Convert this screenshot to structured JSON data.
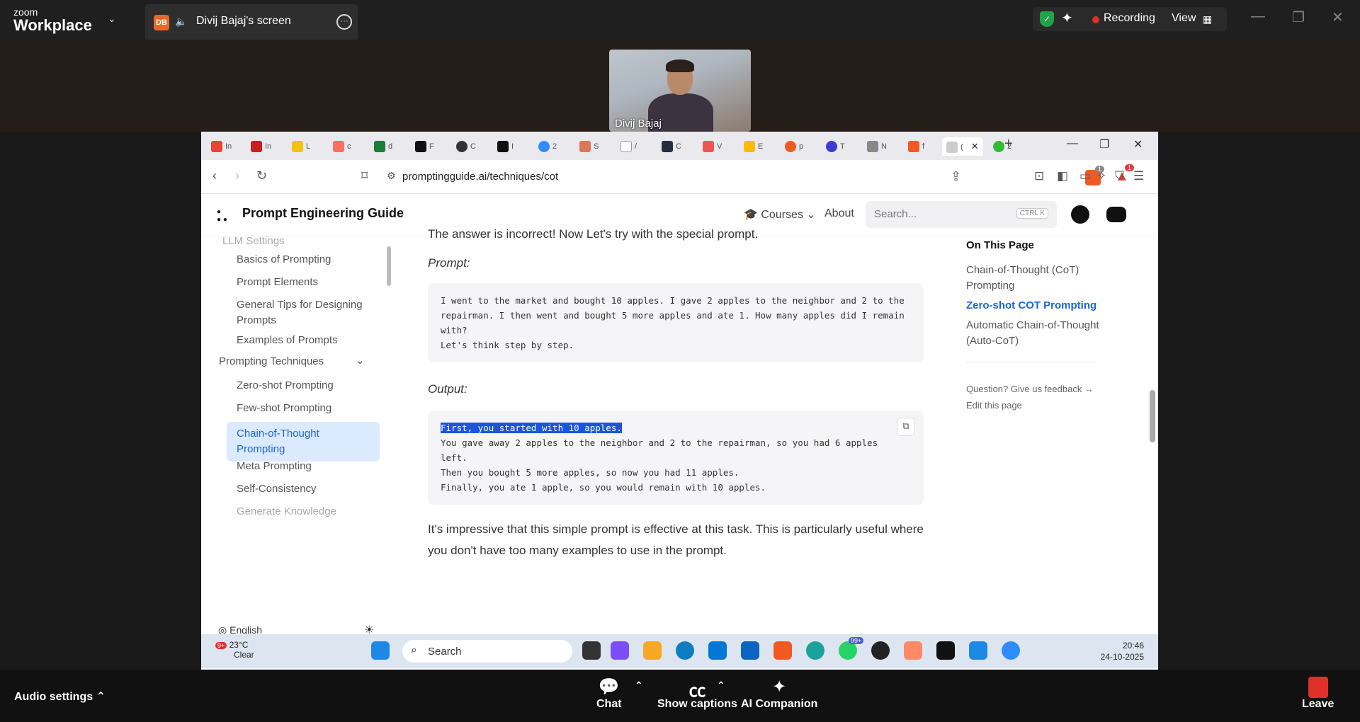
{
  "zoom": {
    "brand_top": "zoom",
    "brand_bottom": "Workplace",
    "share_badge": "DB",
    "share_title": "Divij Bajaj's screen",
    "recording_label": "Recording",
    "view_label": "View",
    "participant_name": "Divij Bajaj",
    "audio_settings": "Audio settings",
    "chat_label": "Chat",
    "captions_label": "Show captions",
    "ai_label": "AI Companion",
    "leave_label": "Leave"
  },
  "browser": {
    "url": "promptingguide.ai/techniques/cot",
    "brave_badge": "1",
    "alert_badge": "1"
  },
  "site": {
    "title": "Prompt Engineering Guide",
    "nav_courses": "Courses",
    "nav_about": "About",
    "search_placeholder": "Search...",
    "search_kbd": "CTRL K"
  },
  "sidebar": {
    "items": [
      {
        "label": "LLM Settings"
      },
      {
        "label": "Basics of Prompting"
      },
      {
        "label": "Prompt Elements"
      },
      {
        "label": "General Tips for Designing Prompts"
      },
      {
        "label": "Examples of Prompts"
      }
    ],
    "section": "Prompting Techniques",
    "sub_items": [
      {
        "label": "Zero-shot Prompting"
      },
      {
        "label": "Few-shot Prompting"
      },
      {
        "label": "Chain-of-Thought Prompting"
      },
      {
        "label": "Meta Prompting"
      },
      {
        "label": "Self-Consistency"
      },
      {
        "label": "Generate Knowledge"
      }
    ],
    "language": "English"
  },
  "main": {
    "intro": "The answer is incorrect! Now Let's try with the special prompt.",
    "prompt_label": "Prompt:",
    "prompt_code": "I went to the market and bought 10 apples. I gave 2 apples to the neighbor and 2 to the repairman. I then went and bought 5 more apples and ate 1. How many apples did I remain with?\nLet's think step by step.",
    "output_label": "Output:",
    "output_first": "First, you started with 10 apples.",
    "output_rest": "\nYou gave away 2 apples to the neighbor and 2 to the repairman, so you had 6 apples left.\nThen you bought 5 more apples, so now you had 11 apples.\nFinally, you ate 1 apple, so you would remain with 10 apples.",
    "conclusion": "It's impressive that this simple prompt is effective at this task. This is particularly useful where you don't have too many examples to use in the prompt."
  },
  "toc": {
    "heading": "On This Page",
    "links": [
      {
        "label": "Chain-of-Thought (CoT) Prompting"
      },
      {
        "label": "Zero-shot COT Prompting"
      },
      {
        "label": "Automatic Chain-of-Thought (Auto-CoT)"
      }
    ],
    "feedback": "Question? Give us feedback →",
    "edit": "Edit this page"
  },
  "taskbar": {
    "weather_badge": "9+",
    "temp": "23°C",
    "condition": "Clear",
    "search": "Search",
    "whatsapp_badge": "99+",
    "time": "20:46",
    "date": "24-10-2025"
  },
  "colors": {
    "accent": "#1a66d6",
    "active_sidebar": "#dbeafe",
    "selection": "#1a56db",
    "recording": "#e0302b"
  }
}
